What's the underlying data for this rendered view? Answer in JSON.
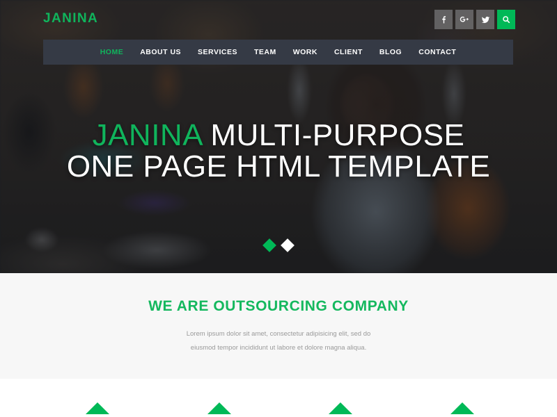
{
  "brand": {
    "logo_text": "JANINA",
    "accent_color": "#10b45c",
    "nav_bg_color": "#353a45",
    "green": "#00b957"
  },
  "topbar": {
    "social": [
      {
        "name": "facebook-icon",
        "label": "f"
      },
      {
        "name": "google-plus-icon",
        "label": "g+"
      },
      {
        "name": "twitter-icon",
        "label": "t"
      },
      {
        "name": "search-icon",
        "label": "search"
      }
    ]
  },
  "nav": {
    "items": [
      {
        "label": "HOME",
        "active": true
      },
      {
        "label": "ABOUT US",
        "active": false
      },
      {
        "label": "SERVICES",
        "active": false
      },
      {
        "label": "TEAM",
        "active": false
      },
      {
        "label": "WORK",
        "active": false
      },
      {
        "label": "CLIENT",
        "active": false
      },
      {
        "label": "BLOG",
        "active": false
      },
      {
        "label": "CONTACT",
        "active": false
      }
    ]
  },
  "hero": {
    "line1_accent": "JANINA",
    "line1_rest": " MULTI-PURPOSE",
    "line2": "ONE PAGE HTML TEMPLATE",
    "carousel": {
      "slides": 2,
      "active_index": 0
    }
  },
  "about": {
    "title": "WE ARE OUTSOURCING COMPANY",
    "paragraph": "Lorem ipsum dolor sit amet, consectetur adipisicing elit, sed do eiusmod tempor incididunt ut labore et dolore magna aliqua."
  },
  "services": {
    "markers": [
      {
        "name": "service-marker-1"
      },
      {
        "name": "service-marker-2"
      },
      {
        "name": "service-marker-3"
      },
      {
        "name": "service-marker-4"
      }
    ]
  }
}
